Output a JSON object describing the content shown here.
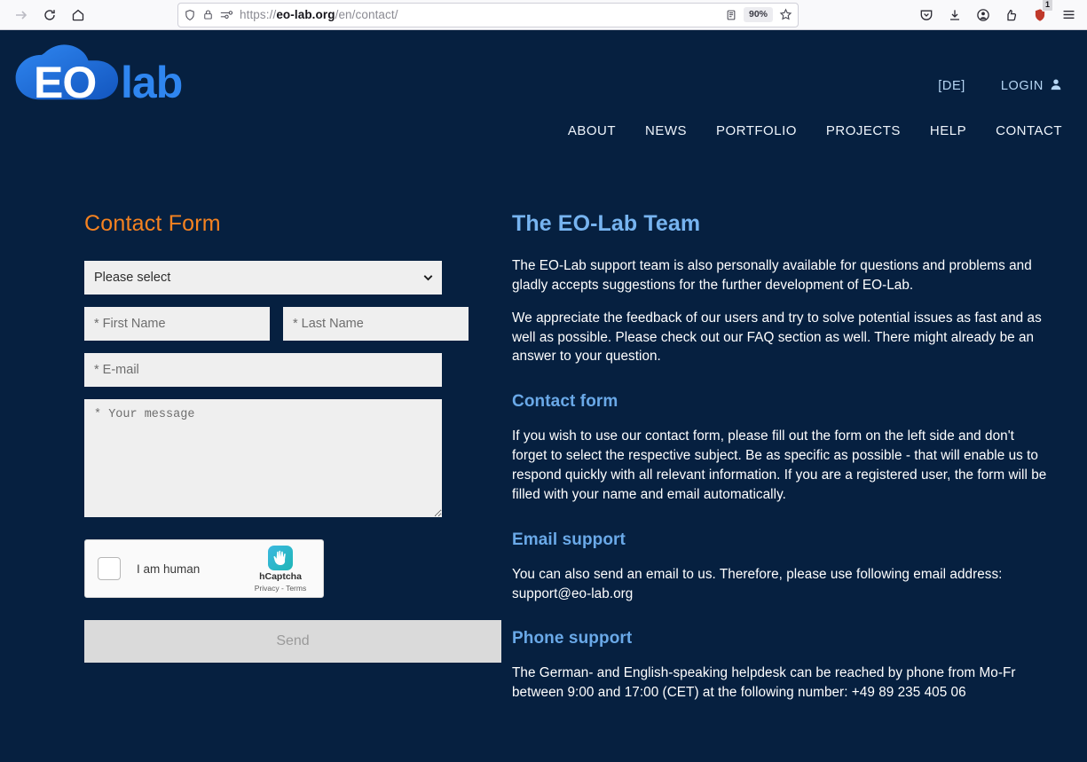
{
  "browser": {
    "back_icon": "back-arrow-icon",
    "reload_icon": "reload-icon",
    "home_icon": "home-icon",
    "shield_icon": "shield-icon",
    "lock_icon": "lock-icon",
    "permissions_icon": "permissions-icon",
    "url_prefix": "https://",
    "url_domain": "eo-lab.org",
    "url_path": "/en/contact/",
    "reader_icon": "reader-view-icon",
    "zoom_level": "90%",
    "bookmark_icon": "star-icon",
    "pocket_icon": "pocket-icon",
    "downloads_icon": "download-icon",
    "account_icon": "account-icon",
    "extensions_icon": "extensions-icon",
    "tracker_icon": "shield-badge-icon",
    "tracker_badge": "1",
    "menu_icon": "hamburger-menu-icon"
  },
  "site": {
    "logo_eo": "EO",
    "logo_lab": "lab",
    "utility": [
      {
        "label": "[DE]",
        "name": "language-switch"
      },
      {
        "label": "LOGIN",
        "name": "login-link",
        "icon": "user-icon"
      }
    ],
    "nav": [
      {
        "label": "ABOUT"
      },
      {
        "label": "NEWS"
      },
      {
        "label": "PORTFOLIO"
      },
      {
        "label": "PROJECTS"
      },
      {
        "label": "HELP"
      },
      {
        "label": "CONTACT"
      }
    ]
  },
  "form": {
    "title": "Contact Form",
    "subject_selected": "Please select",
    "first_name_placeholder": "* First Name",
    "last_name_placeholder": "* Last Name",
    "email_placeholder": "* E-mail",
    "message_placeholder": "* Your message",
    "captcha": {
      "checkbox_label": "I am human",
      "brand": "hCaptcha",
      "links": "Privacy - Terms",
      "logo_icon": "hcaptcha-hand-icon"
    },
    "send_label": "Send"
  },
  "team": {
    "title": "The EO-Lab Team",
    "intro": "The EO-Lab support team is also personally available for questions and problems and gladly accepts suggestions for the further development of EO-Lab.",
    "feedback": "We appreciate the feedback of our users and try to solve potential issues as fast and as well as possible. Please check out our FAQ section as well. There might already be an answer to your question.",
    "contact_form_heading": "Contact form",
    "contact_form_text": "If you wish to use our contact form, please fill out the form on the left side and don't forget to select the respective subject. Be as specific as possible - that will enable us to respond quickly with all relevant information. If you are a registered user, the form will be filled with your name and email automatically.",
    "email_heading": "Email support",
    "email_text": "You can also send an email to us. Therefore, please use following email address: support@eo-lab.org",
    "phone_heading": "Phone support",
    "phone_text": "The German- and English-speaking helpdesk can be reached by phone from Mo-Fr between 9:00 and 17:00 (CET) at the following number: +49 89 235 405 06"
  },
  "colors": {
    "page_bg": "#062040",
    "accent_orange": "#f58220",
    "heading_blue": "#77b4f0",
    "logo_blue": "#1b72e8"
  }
}
